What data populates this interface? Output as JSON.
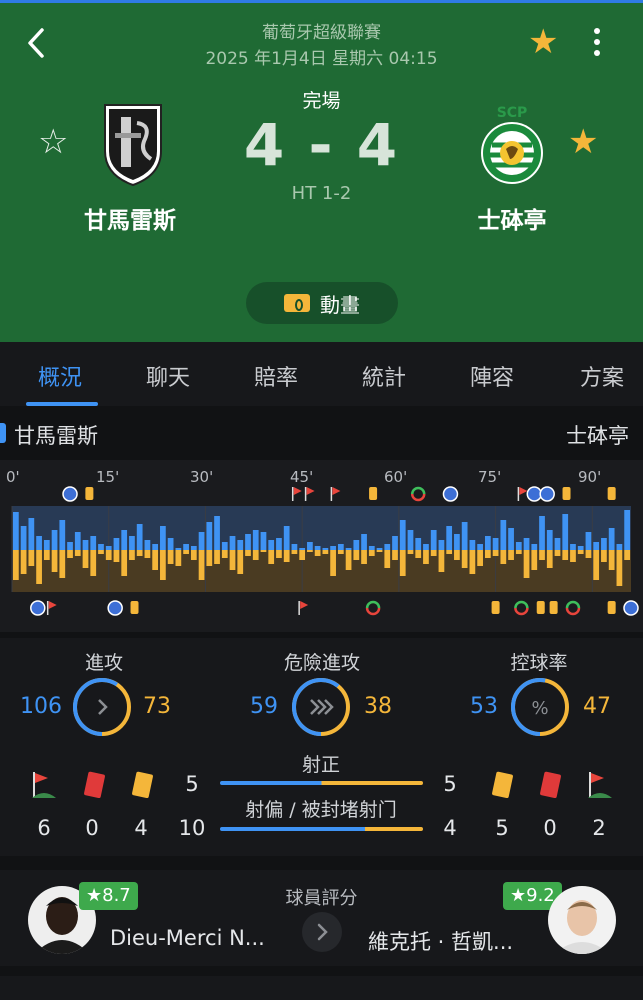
{
  "header": {
    "league": "葡萄牙超級聯賽",
    "datetime": "2025 年1月4日 星期六 04:15",
    "status": "完場",
    "score": "4 - 4",
    "halftime": "HT 1-2",
    "home_team": "甘馬雷斯",
    "away_team": "士砵亭",
    "animation_label": "動畫",
    "away_crest_text": "SCP"
  },
  "tabs": [
    "概況",
    "聊天",
    "賠率",
    "統計",
    "陣容",
    "方案"
  ],
  "teamrow": {
    "home": "甘馬雷斯",
    "away": "士砵亭"
  },
  "momentum": {
    "minute_labels": [
      "0'",
      "15'",
      "30'",
      "45'",
      "60'",
      "75'",
      "90'"
    ],
    "home_bars": [
      38,
      24,
      32,
      14,
      10,
      20,
      30,
      8,
      18,
      10,
      14,
      6,
      4,
      12,
      20,
      14,
      26,
      10,
      6,
      24,
      12,
      2,
      6,
      4,
      18,
      28,
      34,
      8,
      14,
      10,
      16,
      20,
      18,
      10,
      12,
      24,
      6,
      2,
      8,
      4,
      2,
      4,
      6,
      2,
      10,
      16,
      4,
      2,
      6,
      14,
      30,
      20,
      12,
      6,
      20,
      10,
      24,
      16,
      28,
      10,
      6,
      14,
      12,
      30,
      22,
      8,
      12,
      6,
      34,
      20,
      12,
      36,
      6,
      4,
      18,
      8,
      12,
      22,
      6,
      40
    ],
    "away_bars": [
      30,
      24,
      16,
      34,
      10,
      22,
      28,
      8,
      6,
      18,
      26,
      4,
      10,
      12,
      26,
      10,
      6,
      8,
      20,
      30,
      14,
      16,
      4,
      10,
      30,
      16,
      14,
      8,
      20,
      24,
      6,
      10,
      2,
      14,
      8,
      12,
      4,
      10,
      2,
      6,
      4,
      26,
      4,
      20,
      10,
      14,
      6,
      2,
      18,
      10,
      26,
      4,
      8,
      14,
      6,
      22,
      4,
      10,
      18,
      24,
      16,
      8,
      6,
      14,
      10,
      4,
      28,
      20,
      10,
      18,
      6,
      10,
      12,
      4,
      8,
      30,
      12,
      20,
      36,
      10
    ],
    "home_events": [
      {
        "minute": 9,
        "type": "ball"
      },
      {
        "minute": 12,
        "type": "yellow"
      },
      {
        "minute": 44,
        "type": "corner"
      },
      {
        "minute": 46,
        "type": "corner"
      },
      {
        "minute": 50,
        "type": "corner"
      },
      {
        "minute": 56,
        "type": "yellow"
      },
      {
        "minute": 63,
        "type": "sub"
      },
      {
        "minute": 68,
        "type": "ball"
      },
      {
        "minute": 79,
        "type": "corner"
      },
      {
        "minute": 81,
        "type": "ball"
      },
      {
        "minute": 83,
        "type": "ball"
      },
      {
        "minute": 86,
        "type": "yellow"
      },
      {
        "minute": 93,
        "type": "yellow"
      }
    ],
    "away_events": [
      {
        "minute": 4,
        "type": "ball"
      },
      {
        "minute": 6,
        "type": "corner"
      },
      {
        "minute": 16,
        "type": "ball"
      },
      {
        "minute": 19,
        "type": "yellow"
      },
      {
        "minute": 45,
        "type": "corner"
      },
      {
        "minute": 56,
        "type": "sub"
      },
      {
        "minute": 75,
        "type": "yellow"
      },
      {
        "minute": 79,
        "type": "sub"
      },
      {
        "minute": 82,
        "type": "yellow"
      },
      {
        "minute": 84,
        "type": "yellow"
      },
      {
        "minute": 87,
        "type": "sub"
      },
      {
        "minute": 93,
        "type": "yellow"
      },
      {
        "minute": 96,
        "type": "ball"
      }
    ]
  },
  "stats": {
    "attack": {
      "label": "進攻",
      "home": 106,
      "away": 73
    },
    "dangerous": {
      "label": "危險進攻",
      "home": 59,
      "away": 38
    },
    "possession": {
      "label": "控球率",
      "home": 53,
      "away": 47,
      "symbol": "%"
    },
    "home_corners": "6",
    "home_red": "0",
    "home_yellow": "4",
    "away_corners": "2",
    "away_red": "0",
    "away_yellow": "5",
    "shots_on": {
      "label": "射正",
      "home": 5,
      "away": 5
    },
    "shots_off": {
      "label": "射偏 / 被封堵射门",
      "home": 10,
      "away": 4
    }
  },
  "ratings": {
    "title": "球員評分",
    "home_player": "Dieu-Merci N...",
    "home_rating": "★8.7",
    "away_player": "維克托 · 哲凱...",
    "away_rating": "★9.2"
  },
  "colors": {
    "home": "#3f93f4",
    "away": "#f4b63a",
    "header_bg": "#1f6a34"
  }
}
